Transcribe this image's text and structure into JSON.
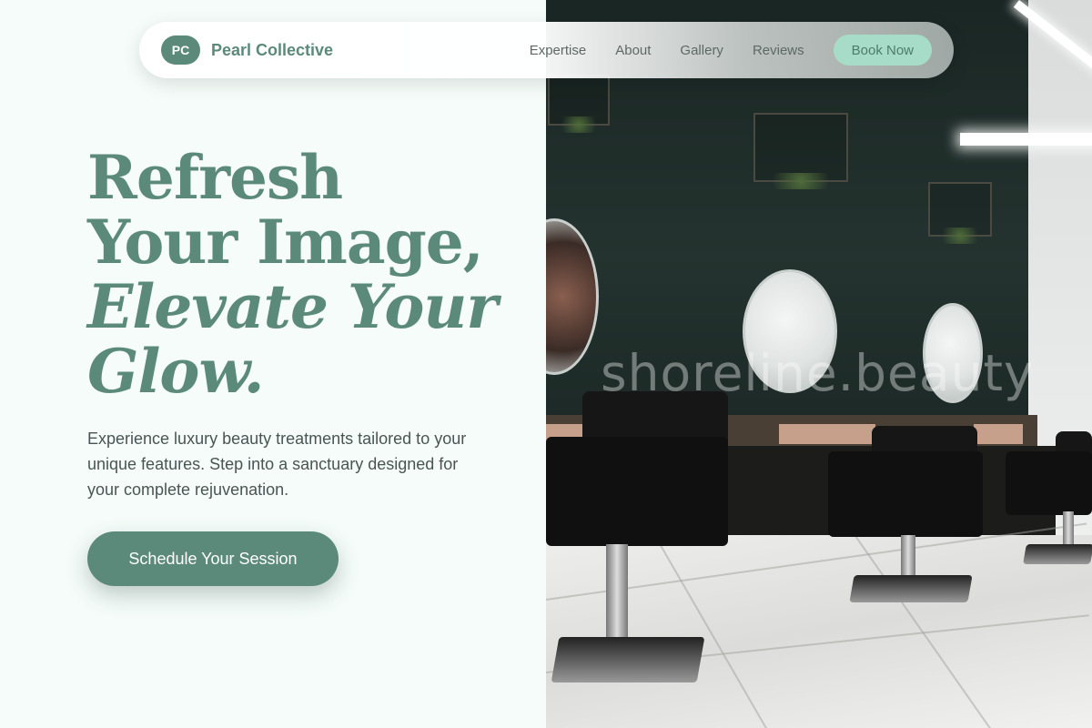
{
  "nav": {
    "logo_initials": "PC",
    "brand_name": "Pearl Collective",
    "links": [
      "Expertise",
      "About",
      "Gallery",
      "Reviews"
    ],
    "cta_label": "Book Now"
  },
  "hero": {
    "title_line1": "Refresh",
    "title_line2": "Your Image,",
    "title_line3": "Elevate Your",
    "title_line4": "Glow.",
    "subtitle": "Experience luxury beauty treatments tailored to your unique features. Step into a sanctuary designed for your complete rejuvenation.",
    "cta_label": "Schedule Your Session"
  },
  "image": {
    "watermark": "shoreline.beauty"
  },
  "colors": {
    "brand": "#5c8a7a",
    "accent_soft": "#a7dcc8",
    "background": "#f5fcf9"
  }
}
